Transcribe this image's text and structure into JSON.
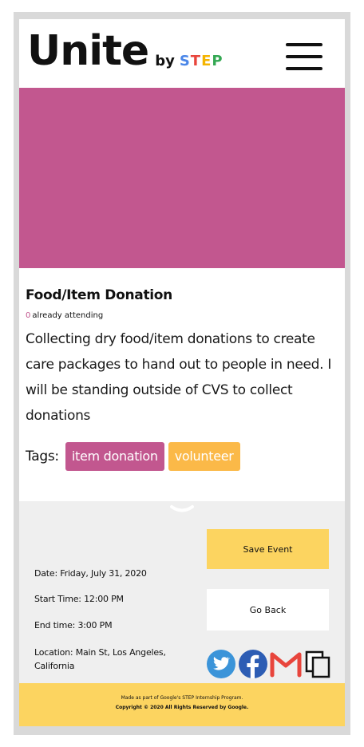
{
  "header": {
    "logo_main": "Unite",
    "logo_by": "by",
    "logo_step_letters": [
      {
        "char": "S",
        "color": "#4a86e8"
      },
      {
        "char": "T",
        "color": "#e8453c"
      },
      {
        "char": "E",
        "color": "#f4b400"
      },
      {
        "char": "P",
        "color": "#34a853"
      }
    ],
    "menu_icon": "hamburger-menu-icon"
  },
  "hero": {
    "color": "#c2578f"
  },
  "event": {
    "title": "Food/Item Donation",
    "attending_count": "0",
    "attending_label": "already attending",
    "description": "Collecting dry food/item donations to create care packages to hand out to people in need. I will be standing outside of CVS to collect donations",
    "tags_label": "Tags:",
    "tags": [
      {
        "label": "item donation",
        "color": "#c2578f"
      },
      {
        "label": "volunteer",
        "color": "#fbb948"
      }
    ]
  },
  "details": {
    "date": "Date: Friday, July 31, 2020",
    "start_time": "Start Time: 12:00 PM",
    "end_time": "End time: 3:00 PM",
    "location": "Location: Main St, Los Angeles, California",
    "save_label": "Save Event",
    "back_label": "Go Back",
    "share_icons": [
      "twitter-icon",
      "facebook-icon",
      "gmail-icon",
      "copy-link-icon"
    ]
  },
  "footer": {
    "line1": "Made as part of Google's STEP Internship Program.",
    "line2": "Copyright © 2020 All Rights Reserved by Google."
  }
}
